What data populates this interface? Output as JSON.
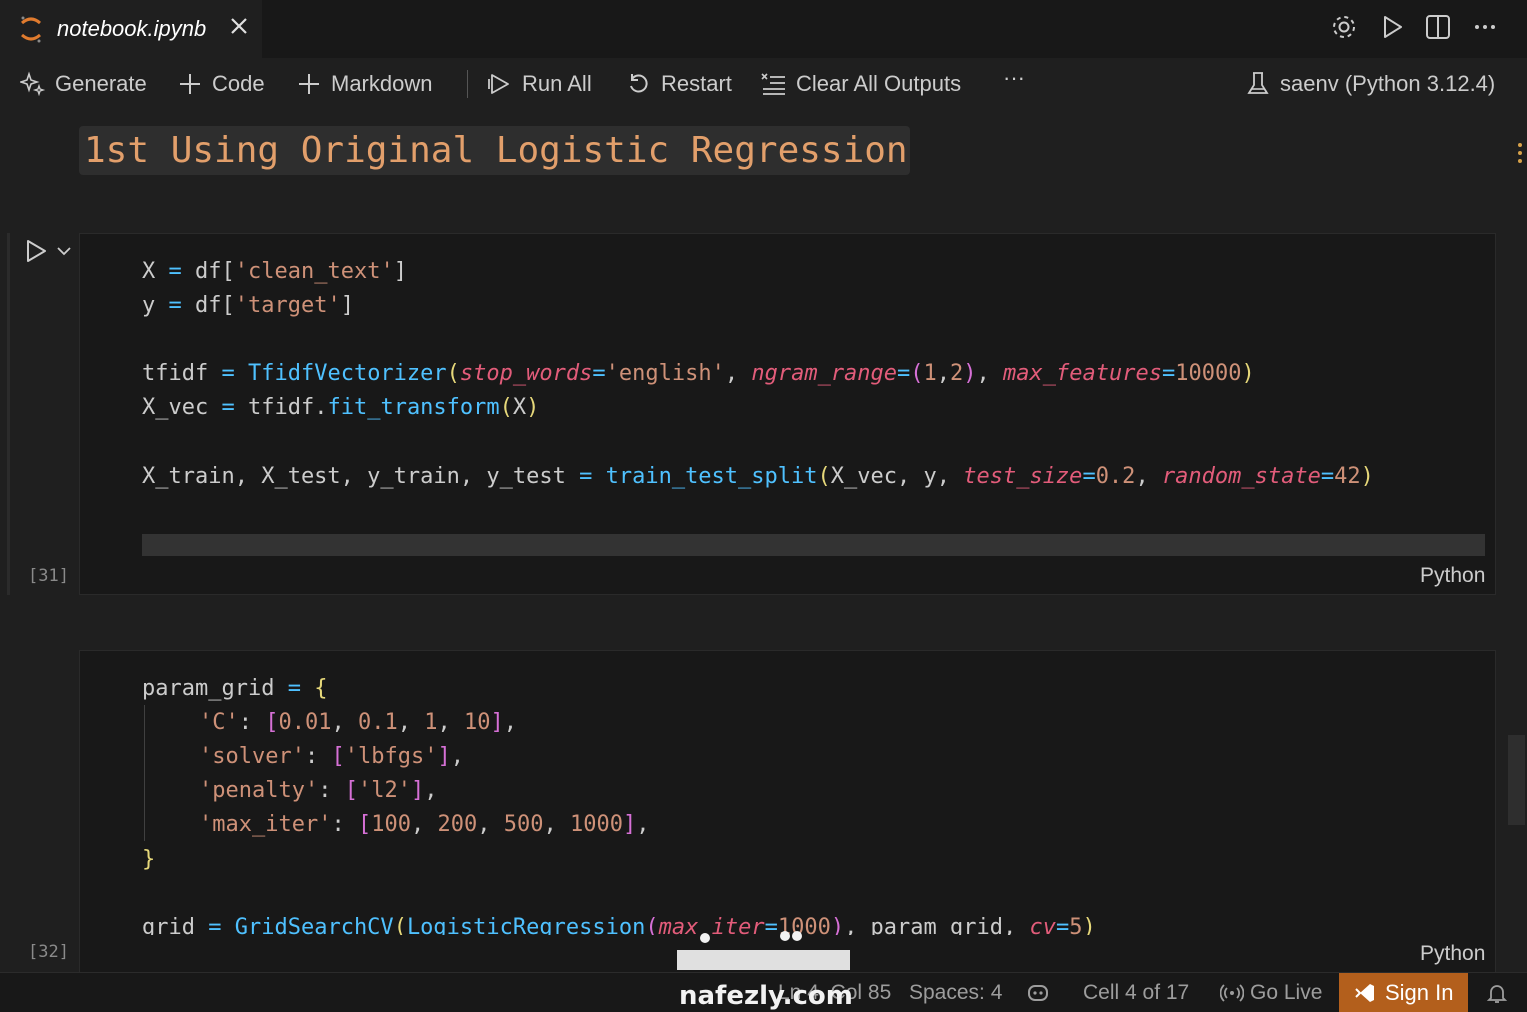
{
  "tab": {
    "filename": "notebook.ipynb"
  },
  "toolbar": {
    "generate": "Generate",
    "code": "Code",
    "markdown": "Markdown",
    "run_all": "Run All",
    "restart": "Restart",
    "clear_all_outputs": "Clear All Outputs",
    "more": "···",
    "kernel": "saenv (Python 3.12.4)"
  },
  "markdown_cell": {
    "heading": "1st Using Original Logistic Regression"
  },
  "cells": [
    {
      "execution_count": "[31]",
      "language": "Python"
    },
    {
      "execution_count": "[32]",
      "language": "Python"
    }
  ],
  "code": {
    "c1": {
      "l1_a": "X",
      "l1_b": "=",
      "l1_c": "df[",
      "l1_d": "'clean_text'",
      "l1_e": "]",
      "l2_a": "y",
      "l2_b": "=",
      "l2_c": "df[",
      "l2_d": "'target'",
      "l2_e": "]",
      "l3_a": "tfidf",
      "l3_b": "=",
      "l3_c": "TfidfVectorizer",
      "l3_d": "(",
      "l3_e": "stop_words",
      "l3_f": "=",
      "l3_g": "'english'",
      "l3_h": ", ",
      "l3_i": "ngram_range",
      "l3_j": "=",
      "l3_k": "(",
      "l3_l": "1",
      "l3_m": ",",
      "l3_n": "2",
      "l3_o": ")",
      "l3_p": ", ",
      "l3_q": "max_features",
      "l3_r": "=",
      "l3_s": "10000",
      "l3_t": ")",
      "l4_a": "X_vec",
      "l4_b": "=",
      "l4_c": "tfidf.",
      "l4_d": "fit_transform",
      "l4_e": "(",
      "l4_f": "X",
      "l4_g": ")",
      "l5_a": "X_train, X_test, y_train, y_test",
      "l5_b": "=",
      "l5_c": "train_test_split",
      "l5_d": "(",
      "l5_e": "X_vec, y, ",
      "l5_f": "test_size",
      "l5_g": "=",
      "l5_h": "0.2",
      "l5_i": ", ",
      "l5_j": "random_state",
      "l5_k": "=",
      "l5_l": "42",
      "l5_m": ")"
    },
    "c2": {
      "l1_a": "param_grid",
      "l1_b": "=",
      "l1_c": "{",
      "l2_a": "'C'",
      "l2_b": ": ",
      "l2_c": "[",
      "l2_d": "0.01",
      "l2_e": ", ",
      "l2_f": "0.1",
      "l2_g": ", ",
      "l2_h": "1",
      "l2_i": ", ",
      "l2_j": "10",
      "l2_k": "]",
      "l2_l": ",",
      "l3_a": "'solver'",
      "l3_b": ": ",
      "l3_c": "[",
      "l3_d": "'lbfgs'",
      "l3_e": "]",
      "l3_f": ",",
      "l4_a": "'penalty'",
      "l4_b": ": ",
      "l4_c": "[",
      "l4_d": "'l2'",
      "l4_e": "]",
      "l4_f": ",",
      "l5_a": "'max_iter'",
      "l5_b": ": ",
      "l5_c": "[",
      "l5_d": "100",
      "l5_e": ", ",
      "l5_f": "200",
      "l5_g": ", ",
      "l5_h": "500",
      "l5_i": ", ",
      "l5_j": "1000",
      "l5_k": "]",
      "l5_l": ",",
      "l6_a": "}",
      "l7_a": "grid",
      "l7_b": "=",
      "l7_c": "GridSearchCV",
      "l7_d": "(",
      "l7_e": "LogisticRegression",
      "l7_f": "(",
      "l7_g": "max_iter",
      "l7_h": "=",
      "l7_i": "1000",
      "l7_j": ")",
      "l7_k": ", param_grid, ",
      "l7_l": "cv",
      "l7_m": "=",
      "l7_n": "5",
      "l7_o": ")"
    }
  },
  "statusbar": {
    "position": "Ln 4, Col 85",
    "spaces": "Spaces: 4",
    "cell": "Cell 4 of 17",
    "go_live": "Go Live",
    "sign_in": "Sign In"
  },
  "watermark": {
    "text": "nafezly.com"
  },
  "colors": {
    "accent_orange": "#b35f1c",
    "string": "#ce9178",
    "function": "#4fc1ff",
    "param": "#e25c7a",
    "heading": "#e29f6b"
  }
}
